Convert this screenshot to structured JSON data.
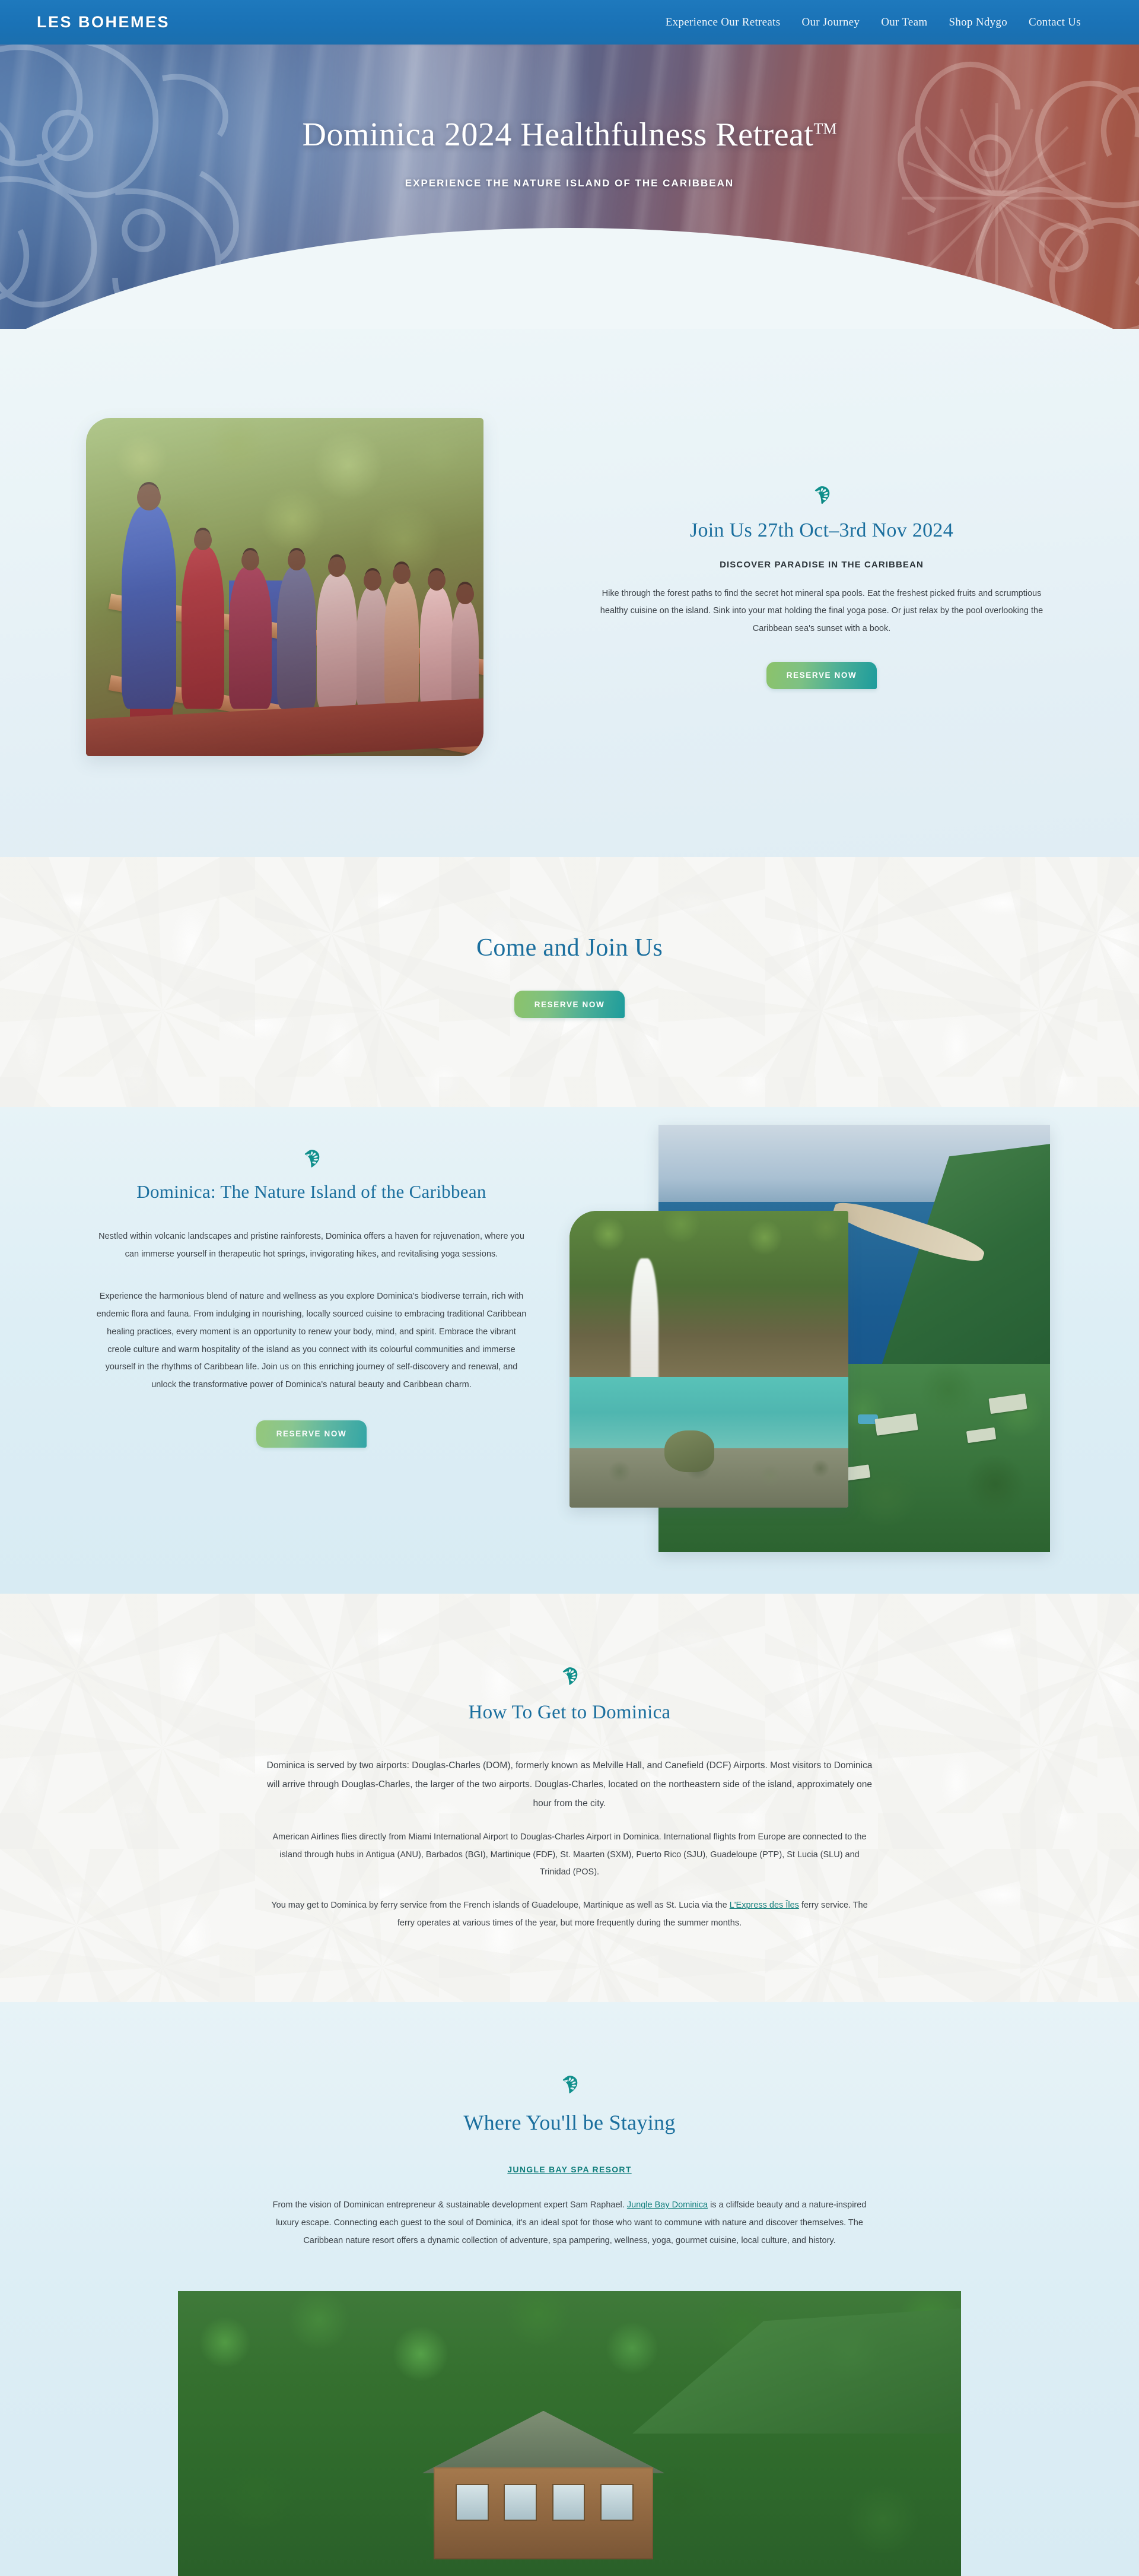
{
  "brand": {
    "name": "LES BOHEMES"
  },
  "nav": {
    "items": [
      {
        "label": "Experience Our Retreats"
      },
      {
        "label": "Our Journey"
      },
      {
        "label": "Our Team"
      },
      {
        "label": "Shop Ndygo"
      },
      {
        "label": "Contact Us"
      }
    ]
  },
  "hero": {
    "title": "Dominica 2024 Healthfulness Retreat",
    "trademark": "TM",
    "subtitle": "EXPERIENCE THE NATURE ISLAND OF THE CARIBBEAN"
  },
  "join": {
    "heading": "Join Us 27th Oct–3rd Nov 2024",
    "kicker": "DISCOVER PARADISE IN THE CARIBBEAN",
    "paragraph": "Hike through the forest paths to find the secret hot mineral spa pools. Eat the freshest picked fruits and scrumptious healthy cuisine on the island. Sink into your mat holding the final yoga pose. Or just relax by the pool overlooking the Caribbean sea's sunset with a book.",
    "cta_label": "RESERVE NOW"
  },
  "cta_band": {
    "heading": "Come and Join Us",
    "cta_label": "RESERVE NOW"
  },
  "island": {
    "heading": "Dominica: The Nature Island of the Caribbean",
    "paragraph1": "Nestled within volcanic landscapes and pristine rainforests, Dominica offers a haven for rejuvenation, where you can immerse yourself in therapeutic hot springs, invigorating hikes, and revitalising yoga sessions.",
    "paragraph2": "Experience the harmonious blend of nature and wellness as you explore Dominica's biodiverse terrain, rich with endemic flora and fauna. From indulging in nourishing, locally sourced cuisine to embracing traditional Caribbean healing practices, every moment is an opportunity to renew your body, mind, and spirit. Embrace the vibrant creole culture and warm hospitality of the island as you connect with its colourful communities and immerse yourself in the rhythms of Caribbean life. Join us on this enriching journey of self-discovery and renewal, and unlock the transformative power of Dominica's natural beauty and Caribbean charm.",
    "cta_label": "RESERVE NOW"
  },
  "travel": {
    "heading": "How To Get to Dominica",
    "paragraph1": "Dominica is served by two airports: Douglas-Charles (DOM), formerly known as Melville Hall, and Canefield (DCF) Airports. Most visitors to Dominica will arrive through Douglas-Charles, the larger of the two airports. Douglas-Charles, located on the northeastern side of the island, approximately one hour from the city.",
    "paragraph2": "American Airlines flies directly from Miami International Airport to Douglas-Charles Airport in Dominica. International flights from Europe are connected to the island through hubs in Antigua (ANU), Barbados (BGI), Martinique (FDF), St. Maarten (SXM), Puerto Rico (SJU), Guadeloupe (PTP), St Lucia (SLU) and Trinidad (POS).",
    "paragraph3_before": "You may get to Dominica by ferry service from the French islands of Guadeloupe, Martinique as well as St. Lucia via the ",
    "paragraph3_link": "L'Express des Îles",
    "paragraph3_after": " ferry service. The ferry operates at various times of the year, but more frequently during the summer months."
  },
  "stay": {
    "heading": "Where You'll be Staying",
    "resort_link": "JUNGLE BAY SPA RESORT",
    "paragraph_before": "From the vision of Dominican entrepreneur & sustainable development expert Sam Raphael. ",
    "paragraph_link": "Jungle Bay Dominica",
    "paragraph_after": " is a cliffside beauty and a nature-inspired luxury escape. Connecting each guest to the soul of Dominica, it's an ideal spot for those who want to commune with nature and discover themselves. The Caribbean nature resort offers a dynamic collection of adventure, spa pampering, wellness, yoga, gourmet cuisine, local culture, and history."
  },
  "icons": {
    "leaf": "monstera-leaf-icon"
  },
  "colors": {
    "header_blue": "#1a72b6",
    "heading_blue": "#1b6f9e",
    "leaf_teal": "#0f8f8b",
    "link_teal": "#0f7d7a",
    "button_gradient_start": "#8cc26a",
    "button_gradient_end": "#1d9c9c"
  }
}
